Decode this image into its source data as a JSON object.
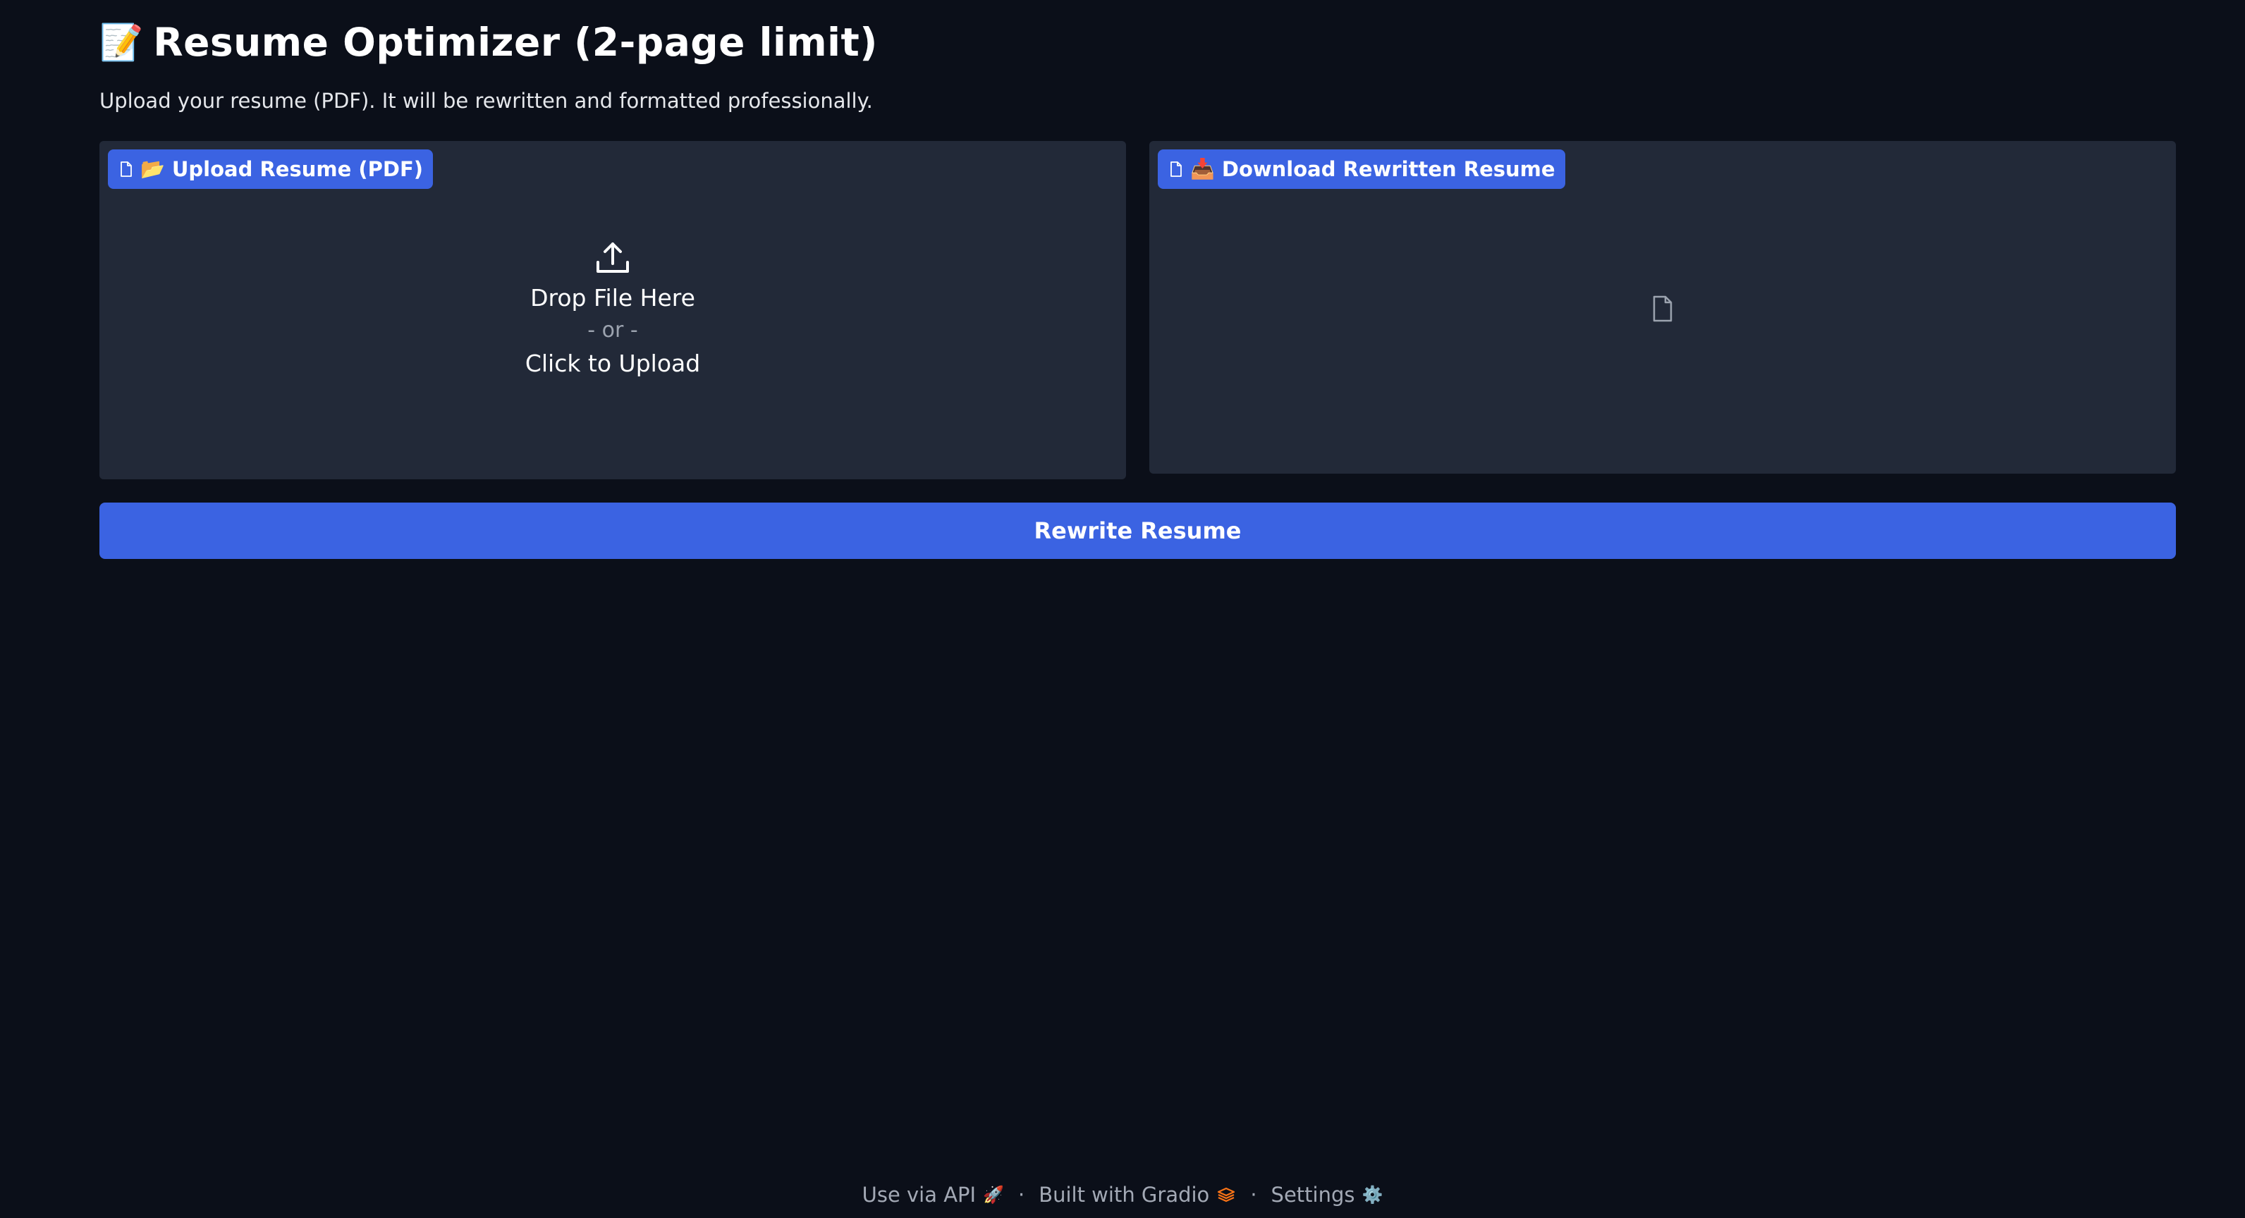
{
  "header": {
    "title_emoji": "📝",
    "title": "Resume Optimizer (2-page limit)",
    "subtitle": "Upload your resume (PDF). It will be rewritten and formatted professionally."
  },
  "upload_panel": {
    "label_icon": "file-icon",
    "label_emoji": "📂",
    "label": "Upload Resume (PDF)",
    "upload_icon": "upload-icon",
    "drop_text": "Drop File Here",
    "or_text": "- or -",
    "click_text": "Click to Upload"
  },
  "download_panel": {
    "label_icon": "file-icon",
    "label_emoji": "📥",
    "label": "Download Rewritten Resume",
    "placeholder_icon": "file-icon"
  },
  "actions": {
    "rewrite_label": "Rewrite Resume"
  },
  "footer": {
    "api_label": "Use via API",
    "api_icon": "rocket-icon",
    "api_emoji": "🚀",
    "separator": "·",
    "built_label": "Built with Gradio",
    "gradio_icon": "gradio-logo-icon",
    "settings_label": "Settings",
    "settings_icon": "gear-icon",
    "settings_emoji": "⚙️"
  },
  "colors": {
    "background": "#0b0f19",
    "panel": "#222938",
    "accent": "#3b63e2",
    "muted_text": "#9ca3af",
    "gradio_orange": "#f97316"
  }
}
